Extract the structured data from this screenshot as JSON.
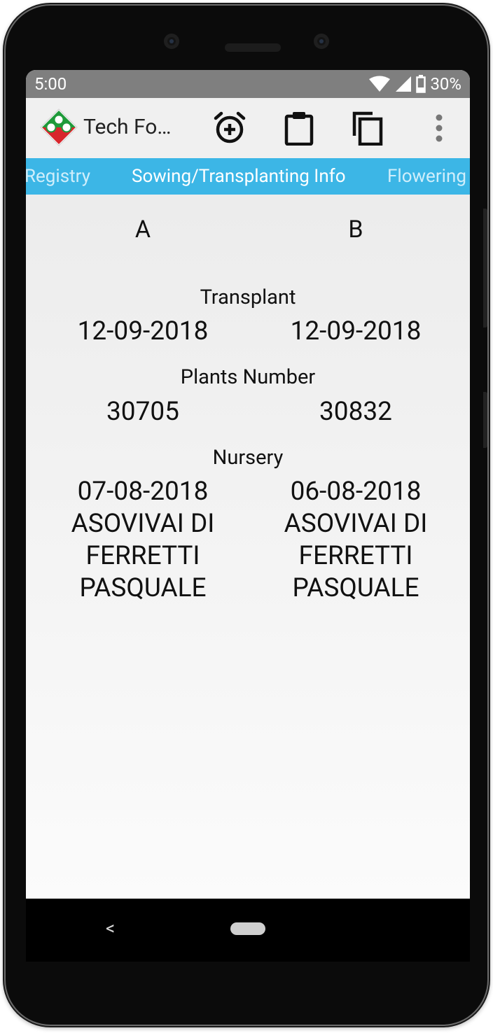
{
  "status": {
    "time": "5:00",
    "battery": "30%"
  },
  "toolbar": {
    "title": "Tech Fo…",
    "icons": [
      "add-alarm-icon",
      "clipboard-icon",
      "copy-icon",
      "more-vert-icon"
    ]
  },
  "tabs": [
    {
      "label": "Registry",
      "active": false
    },
    {
      "label": "Sowing/Transplanting Info",
      "active": true
    },
    {
      "label": "Flowering",
      "active": false
    }
  ],
  "columns": {
    "a": "A",
    "b": "B"
  },
  "transplant": {
    "label": "Transplant",
    "a": "12-09-2018",
    "b": "12-09-2018"
  },
  "plants": {
    "label": "Plants Number",
    "a": "30705",
    "b": "30832"
  },
  "nursery": {
    "label": "Nursery",
    "a": {
      "date": "07-08-2018",
      "name_line1": "ASOVIVAI DI",
      "name_line2": "FERRETTI",
      "name_line3": "PASQUALE"
    },
    "b": {
      "date": "06-08-2018",
      "name_line1": "ASOVIVAI DI",
      "name_line2": "FERRETTI",
      "name_line3": "PASQUALE"
    }
  },
  "colors": {
    "tab_bar": "#3cb6e6",
    "status_bar": "#7f7f7f",
    "app_bar": "#f0f0f0"
  }
}
